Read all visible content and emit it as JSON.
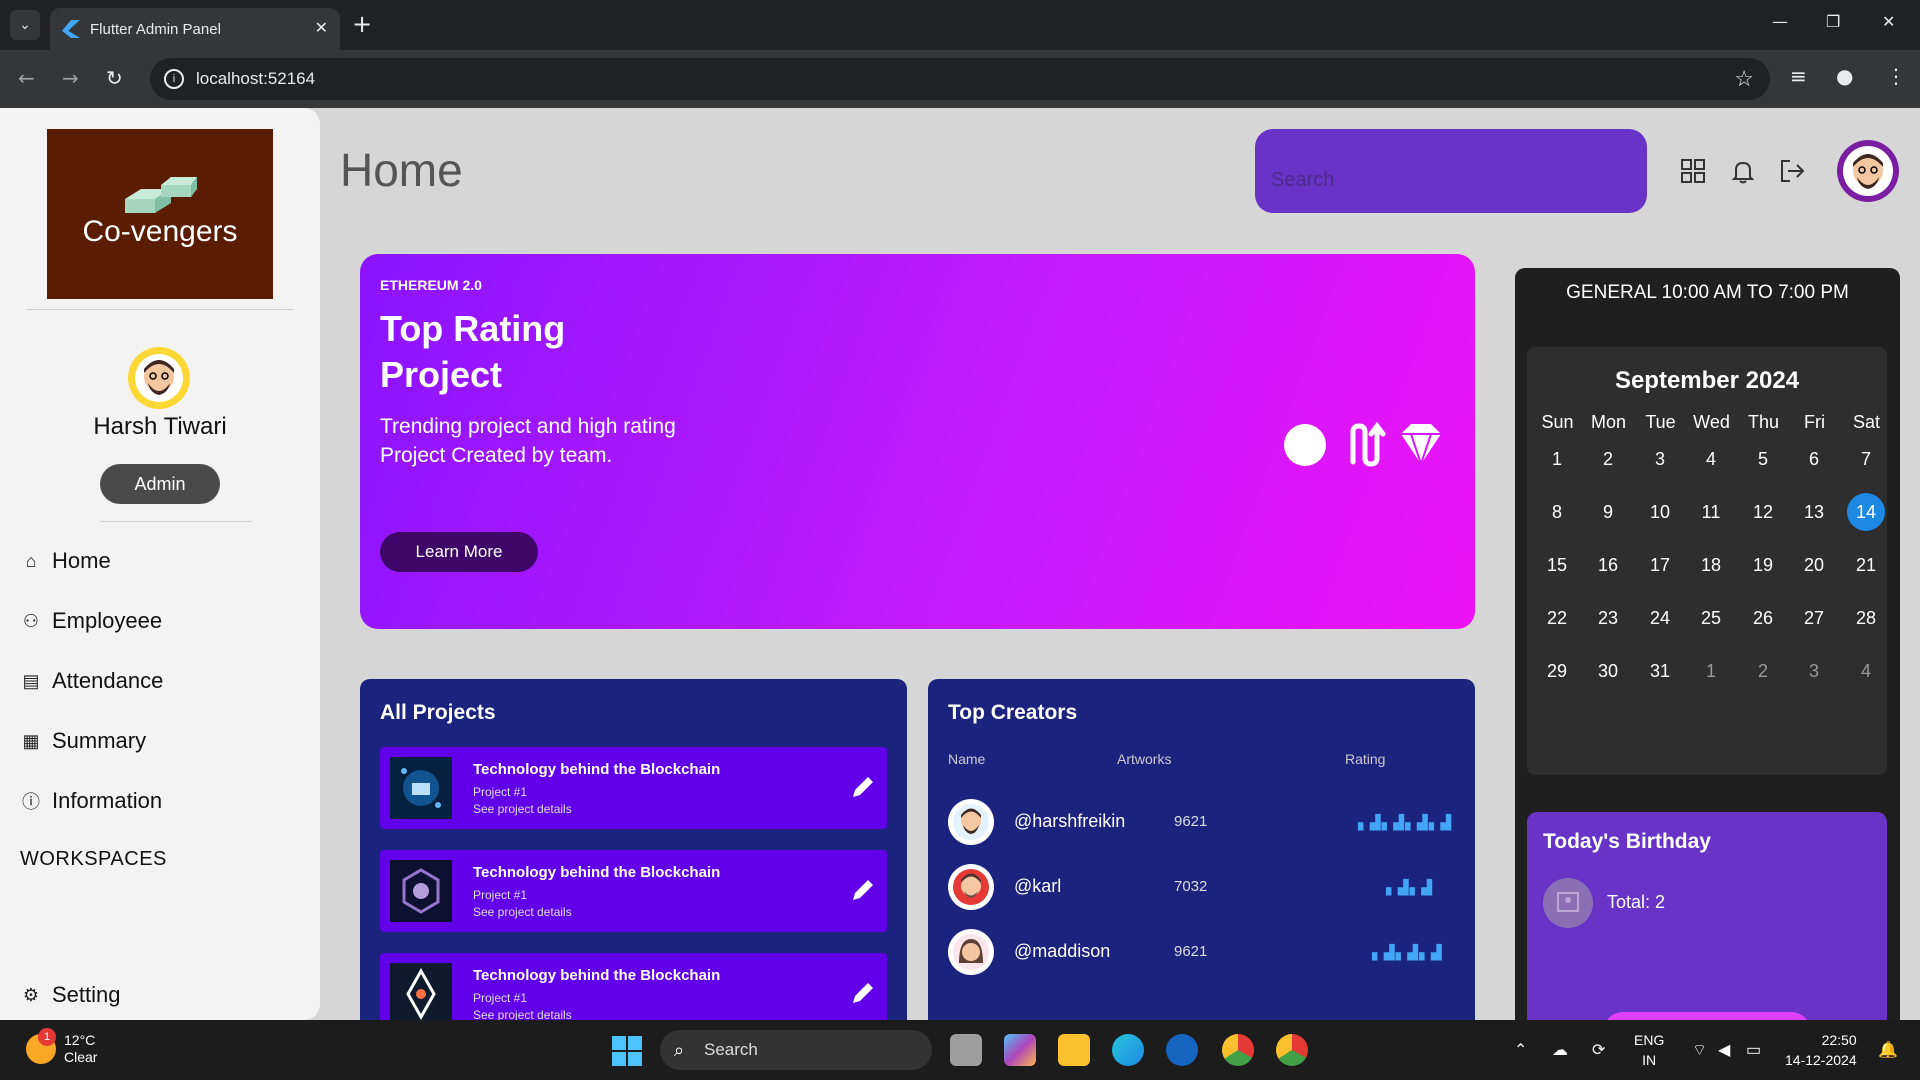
{
  "browser": {
    "tab_title": "Flutter Admin Panel",
    "url": "localhost:52164"
  },
  "sidebar": {
    "logo_text": "Co-vengers",
    "user_name": "Harsh Tiwari",
    "role": "Admin",
    "items": [
      {
        "label": "Home",
        "icon": "home-icon"
      },
      {
        "label": "Employeee",
        "icon": "people-icon"
      },
      {
        "label": "Attendance",
        "icon": "id-card-icon"
      },
      {
        "label": "Summary",
        "icon": "newspaper-icon"
      },
      {
        "label": "Information",
        "icon": "info-icon"
      }
    ],
    "workspaces_label": "WORKSPACES",
    "setting_label": "Setting"
  },
  "header": {
    "title": "Home",
    "search_placeholder": "Search"
  },
  "hero": {
    "tag": "ETHEREUM 2.0",
    "title_line1": "Top Rating",
    "title_line2": "Project",
    "subtitle_line1": "Trending project and high rating",
    "subtitle_line2": "Project Created by team.",
    "button": "Learn More"
  },
  "projects": {
    "title": "All Projects",
    "items": [
      {
        "title": "Technology behind the Blockchain",
        "sub": "Project #1",
        "link": "See project details"
      },
      {
        "title": "Technology behind the Blockchain",
        "sub": "Project #1",
        "link": "See project details"
      },
      {
        "title": "Technology behind the Blockchain",
        "sub": "Project #1",
        "link": "See project details"
      }
    ]
  },
  "creators": {
    "title": "Top Creators",
    "headers": {
      "name": "Name",
      "artworks": "Artworks",
      "rating": "Rating"
    },
    "rows": [
      {
        "name": "@harshfreikin",
        "artworks": "9621",
        "rating_bars": 4
      },
      {
        "name": "@karl",
        "artworks": "7032",
        "rating_bars": 2
      },
      {
        "name": "@maddison",
        "artworks": "9621",
        "rating_bars": 3
      }
    ]
  },
  "right": {
    "shift": "GENERAL 10:00 AM TO 7:00 PM",
    "calendar": {
      "month": "September 2024",
      "weekdays": [
        "Sun",
        "Mon",
        "Tue",
        "Wed",
        "Thu",
        "Fri",
        "Sat"
      ],
      "weeks": [
        [
          "1",
          "2",
          "3",
          "4",
          "5",
          "6",
          "7"
        ],
        [
          "8",
          "9",
          "10",
          "11",
          "12",
          "13",
          "14"
        ],
        [
          "15",
          "16",
          "17",
          "18",
          "19",
          "20",
          "21"
        ],
        [
          "22",
          "23",
          "24",
          "25",
          "26",
          "27",
          "28"
        ],
        [
          "29",
          "30",
          "31",
          "1",
          "2",
          "3",
          "4"
        ]
      ],
      "selected": "14"
    },
    "birthday": {
      "title": "Today's Birthday",
      "total": "Total: 2"
    }
  },
  "taskbar": {
    "temp": "12°C",
    "condition": "Clear",
    "weather_badge": "1",
    "search": "Search",
    "lang1": "ENG",
    "lang2": "IN",
    "time": "22:50",
    "date": "14-12-2024"
  }
}
